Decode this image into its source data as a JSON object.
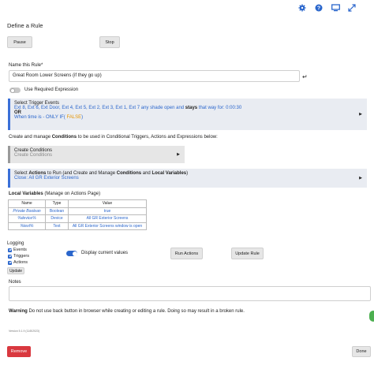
{
  "colors": {
    "accent": "#3a6fd8",
    "link": "#2a66cc",
    "highlight": "#e69500",
    "danger": "#d9383f",
    "toggle_on": "#2a66cc"
  },
  "toolbar": {
    "icons": [
      "gear-icon",
      "help-icon",
      "monitor-icon",
      "expand-icon"
    ]
  },
  "page": {
    "title": "Define a Rule"
  },
  "buttons": {
    "pause": "Pause",
    "stop": "Stop",
    "run_actions": "Run Actions",
    "update_rule": "Update Rule",
    "update": "Update",
    "remove": "Remove",
    "done": "Done"
  },
  "rule_name": {
    "label": "Name this Rule*",
    "value": "Great Room Lower Screens (if they go up)"
  },
  "required_expression": {
    "label": "Use Required Expression",
    "enabled": false
  },
  "triggers": {
    "title": "Select Trigger Events",
    "events": "Ext 8, Ext 6, Ext Door, Ext 4, Ext 5, Ext 2, Ext 3, Ext 1, Ext 7 any shade open and ",
    "stays": "stays",
    "duration": " that way for: 0:00:30",
    "or": "OR",
    "when_prefix": "When time is ",
    "when_mid": " - ONLY IF(",
    "when_false": " FALSE",
    "when_close": ")"
  },
  "conditions_intro": {
    "prefix": "Create and manage ",
    "bold": "Conditions",
    "suffix": " to be used in Conditional Triggers, Actions and Expressions below:"
  },
  "create_conditions": {
    "title": "Create Conditions",
    "subtitle": "Create Conditions"
  },
  "actions": {
    "prefix": "Select ",
    "bold1": "Actions",
    "mid": " to Run (and Create and Manage ",
    "bold2": "Conditions",
    "and": " and ",
    "bold3": "Local Variables",
    "end": ")",
    "subtitle": "Close: All GR Exterior Screens"
  },
  "local_variables": {
    "title": "Local Variables",
    "manage": " (Manage on Actions Page)",
    "headers": [
      "Name",
      "Type",
      "Value"
    ],
    "rows": [
      {
        "name": "Private Boolean",
        "type": "Boolean",
        "value": "true"
      },
      {
        "name": "%device%",
        "type": "Device",
        "value": "All GR Exterior Screens"
      },
      {
        "name": "%text%",
        "type": "Text",
        "value": "All GR Exterior Screens window is open"
      }
    ]
  },
  "logging": {
    "title": "Logging",
    "events": "Events",
    "triggers": "Triggers",
    "actions": "Actions"
  },
  "display_current": {
    "label": "Display current values",
    "enabled": true
  },
  "notes": {
    "label": "Notes",
    "value": ""
  },
  "warning": {
    "bold": "Warning",
    "text": " Do not use back button in browser while creating or editing a rule. Doing so may result in a broken rule."
  },
  "version": "Version 5.1.9 (11/8/2023)"
}
